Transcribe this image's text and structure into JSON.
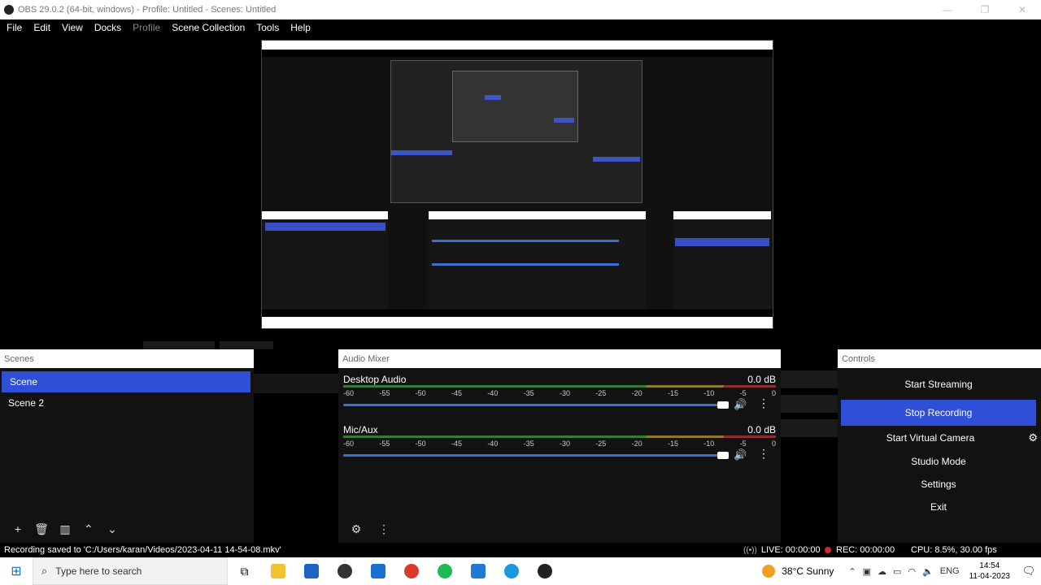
{
  "window": {
    "title": "OBS 29.0.2 (64-bit, windows) - Profile: Untitled - Scenes: Untitled"
  },
  "menu": [
    "File",
    "Edit",
    "View",
    "Docks",
    "Profile",
    "Scene Collection",
    "Tools",
    "Help"
  ],
  "scenes": {
    "header": "Scenes",
    "items": [
      "Scene",
      "Scene 2"
    ],
    "selected": "Scene"
  },
  "mixer": {
    "header": "Audio Mixer",
    "scale": [
      "-60",
      "-55",
      "-50",
      "-45",
      "-40",
      "-35",
      "-30",
      "-25",
      "-20",
      "-15",
      "-10",
      "-5",
      "0"
    ],
    "tracks": [
      {
        "name": "Desktop Audio",
        "db": "0.0 dB"
      },
      {
        "name": "Mic/Aux",
        "db": "0.0 dB"
      }
    ]
  },
  "controls": {
    "header": "Controls",
    "buttons": [
      "Start Streaming",
      "Stop Recording",
      "Start Virtual Camera",
      "Studio Mode",
      "Settings",
      "Exit"
    ],
    "active": "Stop Recording"
  },
  "status": {
    "message": "Recording saved to 'C:/Users/karan/Videos/2023-04-11 14-54-08.mkv'",
    "live": "LIVE: 00:00:00",
    "rec": "REC: 00:00:00",
    "cpu": "CPU: 8.5%, 30.00 fps"
  },
  "taskbar": {
    "search_placeholder": "Type here to search",
    "weather": "38°C  Sunny",
    "lang": "ENG",
    "time": "14:54",
    "date": "11-04-2023"
  },
  "colors": {
    "accent": "#2f4fd6",
    "panel": "#121212",
    "header": "#ffffff"
  }
}
